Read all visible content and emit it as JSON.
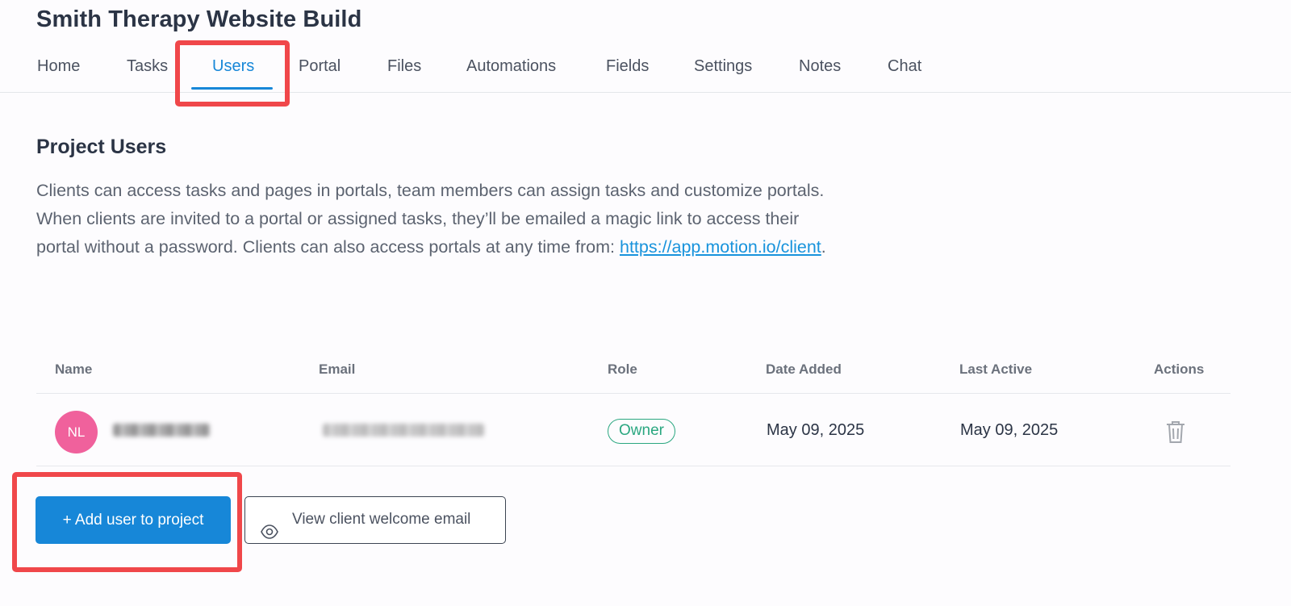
{
  "project": {
    "title": "Smith Therapy Website Build"
  },
  "tabs": [
    {
      "label": "Home"
    },
    {
      "label": "Tasks"
    },
    {
      "label": "Users",
      "active": true
    },
    {
      "label": "Portal"
    },
    {
      "label": "Files"
    },
    {
      "label": "Automations"
    },
    {
      "label": "Fields"
    },
    {
      "label": "Settings"
    },
    {
      "label": "Notes"
    },
    {
      "label": "Chat"
    }
  ],
  "section": {
    "title": "Project Users",
    "description": "Clients can access tasks and pages in portals, team members can assign tasks and customize portals. When clients are invited to a portal or assigned tasks, they’ll be emailed a magic link to access their portal without a password. Clients can also access portals at any time from:",
    "link_text": "https://app.motion.io/client",
    "link_suffix": "."
  },
  "table": {
    "columns": [
      "Name",
      "Email",
      "Role",
      "Date Added",
      "Last Active",
      "Actions"
    ],
    "rows": [
      {
        "initials": "NL",
        "role": "Owner",
        "date_added": "May 09, 2025",
        "last_active": "May 09, 2025",
        "action_icon": "trash-icon"
      }
    ]
  },
  "buttons": {
    "add_user": "+ Add user to project",
    "view_email": "View client welcome email"
  },
  "colors": {
    "accent": "#1787d8",
    "highlight": "#f0474a",
    "owner_badge": "#2aa780",
    "avatar": "#f0619c"
  }
}
